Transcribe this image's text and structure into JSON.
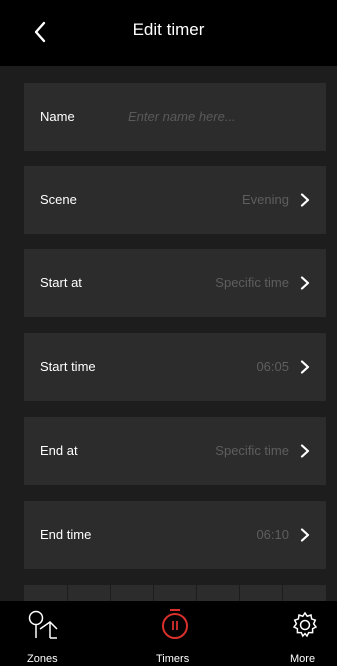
{
  "header": {
    "title": "Edit timer"
  },
  "form": {
    "name_label": "Name",
    "name_placeholder": "Enter name here...",
    "rows": [
      {
        "label": "Scene",
        "value": "Evening"
      },
      {
        "label": "Start at",
        "value": "Specific time"
      },
      {
        "label": "Start time",
        "value": "06:05"
      },
      {
        "label": "End at",
        "value": "Specific time"
      },
      {
        "label": "End time",
        "value": "06:10"
      }
    ]
  },
  "tabbar": {
    "tabs": [
      {
        "label": "Zones",
        "icon": "zones-icon",
        "active": false
      },
      {
        "label": "Timers",
        "icon": "timer-icon",
        "active": true
      },
      {
        "label": "More",
        "icon": "gear-icon",
        "active": false
      }
    ]
  },
  "colors": {
    "background": "#1d1d1d",
    "header": "#000000",
    "row": "#2c2c2c",
    "muted_text": "#5e5e5e",
    "accent": "#d9302c"
  }
}
